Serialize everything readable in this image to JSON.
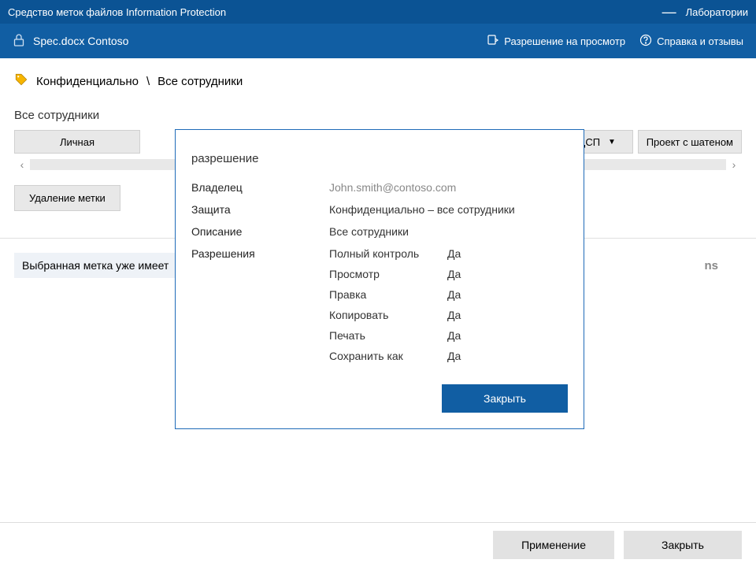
{
  "titlebar": {
    "title": "Средство меток файлов Information Protection",
    "lab": "Лаборатории"
  },
  "subbar": {
    "filename": "Spec.docx Contoso",
    "view_permission": "Разрешение на просмотр",
    "help": "Справка и отзывы"
  },
  "label_line": {
    "prefix": "Конфиденциально",
    "sep": "\\",
    "suffix": "Все сотрудники"
  },
  "section": "Все сотрудники",
  "btns": {
    "b1": "Личная",
    "b2": "СДСП",
    "b3": "Проект с шатеном"
  },
  "delete_label": "Удаление метки",
  "status": {
    "text": "Выбранная метка уже имеет",
    "tail": "ns"
  },
  "footer": {
    "apply": "Применение",
    "close": "Закрыть"
  },
  "dialog": {
    "title": "разрешение",
    "rows": {
      "owner_label": "Владелец",
      "owner_value": "John.smith@contoso.com",
      "protection_label": "Защита",
      "protection_value": "Конфиденциально – все сотрудники",
      "description_label": "Описание",
      "description_value": "Все сотрудники",
      "permissions_label": "Разрешения"
    },
    "perms": [
      {
        "name": "Полный контроль",
        "val": "Да"
      },
      {
        "name": "Просмотр",
        "val": "Да"
      },
      {
        "name": "Правка",
        "val": "Да"
      },
      {
        "name": "Копировать",
        "val": "Да"
      },
      {
        "name": "Печать",
        "val": "Да"
      },
      {
        "name": "Сохранить как",
        "val": "Да"
      }
    ],
    "close": "Закрыть"
  }
}
